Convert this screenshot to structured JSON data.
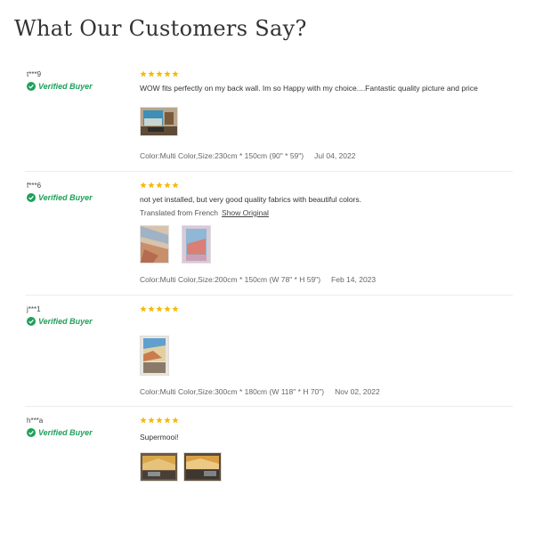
{
  "page": {
    "title": "What Our Customers Say?"
  },
  "colors": {
    "star": "#f5b90a",
    "verified": "#1fa05a"
  },
  "reviews": [
    {
      "user": "t***9",
      "verified_label": "Verified Buyer",
      "rating": 5,
      "comment": "WOW fits perfectly on my back wall. Im so Happy with my choice....Fantastic quality picture and price",
      "meta": "Color:Multi Color,Size:230cm * 150cm (90\" * 59\")",
      "date": "Jul 04, 2022"
    },
    {
      "user": "f***6",
      "verified_label": "Verified Buyer",
      "rating": 5,
      "comment": "not yet installed, but very good quality fabrics with beautiful colors.",
      "translated": "Translated from French",
      "show_original": "Show Original",
      "meta": "Color:Multi Color,Size:200cm * 150cm (W 78\" * H 59\")",
      "date": "Feb 14, 2023"
    },
    {
      "user": "j***1",
      "verified_label": "Verified Buyer",
      "rating": 5,
      "meta": "Color:Multi Color,Size:300cm * 180cm (W 118\" * H 70\")",
      "date": "Nov 02, 2022"
    },
    {
      "user": "h***a",
      "verified_label": "Verified Buyer",
      "rating": 5,
      "comment": "Supermooi!"
    }
  ]
}
